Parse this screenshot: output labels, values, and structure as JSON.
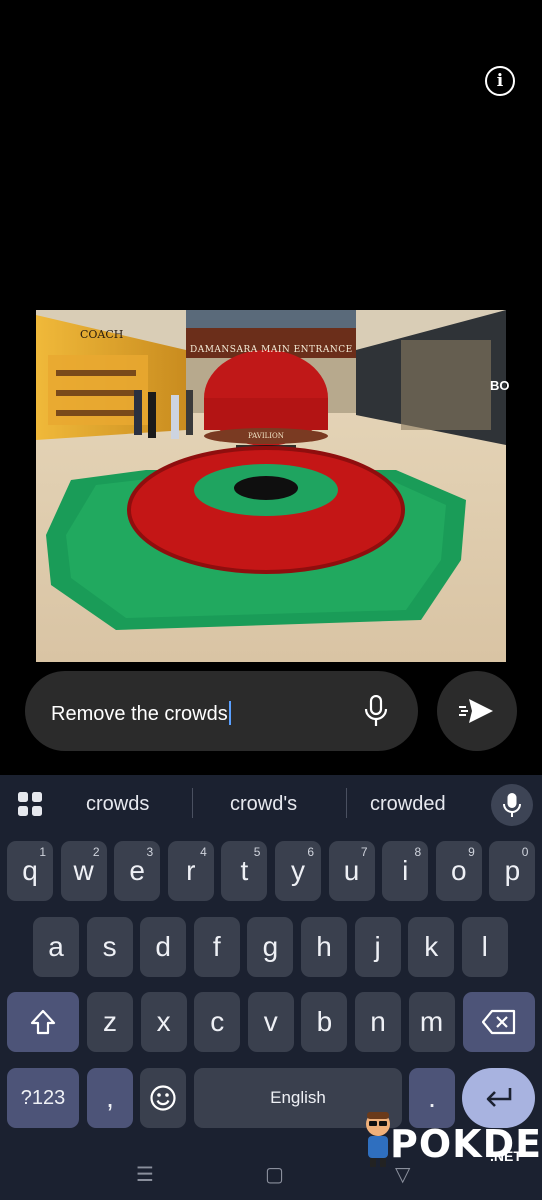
{
  "photo": {
    "store_left": "COACH",
    "caption": "DAMANSARA MAIN ENTRANCE",
    "booth_sign": "PAVILION",
    "store_right": "BO"
  },
  "prompt": {
    "text": "Remove the crowds"
  },
  "keyboard": {
    "suggestions": [
      "crowds",
      "crowd's",
      "crowded"
    ],
    "row1": [
      {
        "key": "q",
        "num": "1"
      },
      {
        "key": "w",
        "num": "2"
      },
      {
        "key": "e",
        "num": "3"
      },
      {
        "key": "r",
        "num": "4"
      },
      {
        "key": "t",
        "num": "5"
      },
      {
        "key": "y",
        "num": "6"
      },
      {
        "key": "u",
        "num": "7"
      },
      {
        "key": "i",
        "num": "8"
      },
      {
        "key": "o",
        "num": "9"
      },
      {
        "key": "p",
        "num": "0"
      }
    ],
    "row2": [
      "a",
      "s",
      "d",
      "f",
      "g",
      "h",
      "j",
      "k",
      "l"
    ],
    "row3": [
      "z",
      "x",
      "c",
      "v",
      "b",
      "n",
      "m"
    ],
    "symbols_label": "?123",
    "comma_label": ",",
    "space_label": "English",
    "period_label": "."
  },
  "watermark": {
    "brand": "POKDE",
    "suffix": ".NET"
  },
  "colors": {
    "background": "#000000",
    "keyboard_bg": "#1b2130",
    "key_bg": "#3a404e",
    "function_key_bg": "#4d5478",
    "enter_key_bg": "#a8b3e0",
    "caret": "#5aa0ff"
  },
  "icons": [
    "info-icon",
    "microphone-icon",
    "send-icon",
    "grid-icon",
    "shift-icon",
    "backspace-icon",
    "emoji-icon",
    "enter-icon",
    "nav-recents-icon",
    "nav-home-icon",
    "nav-back-icon"
  ]
}
